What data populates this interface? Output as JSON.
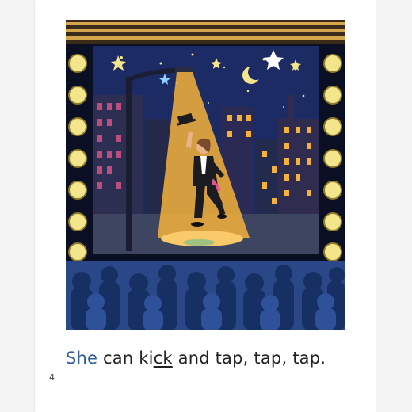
{
  "story": {
    "sentence_parts": {
      "word_1": "She",
      "gap_1": " can ki",
      "underlined": "ck",
      "tail": " and tap, tap, tap."
    },
    "page_number": "4"
  },
  "illustration": {
    "scene": "night-city-stage-tap-dancer",
    "colors": {
      "sky": "#1c2b63",
      "spotlight": "#f5b13a",
      "curtain_gold": "#d4a64b",
      "stage_lights": "#f3e58c",
      "audience": "#203a74",
      "highlight_word": "#2e5f9e"
    }
  }
}
